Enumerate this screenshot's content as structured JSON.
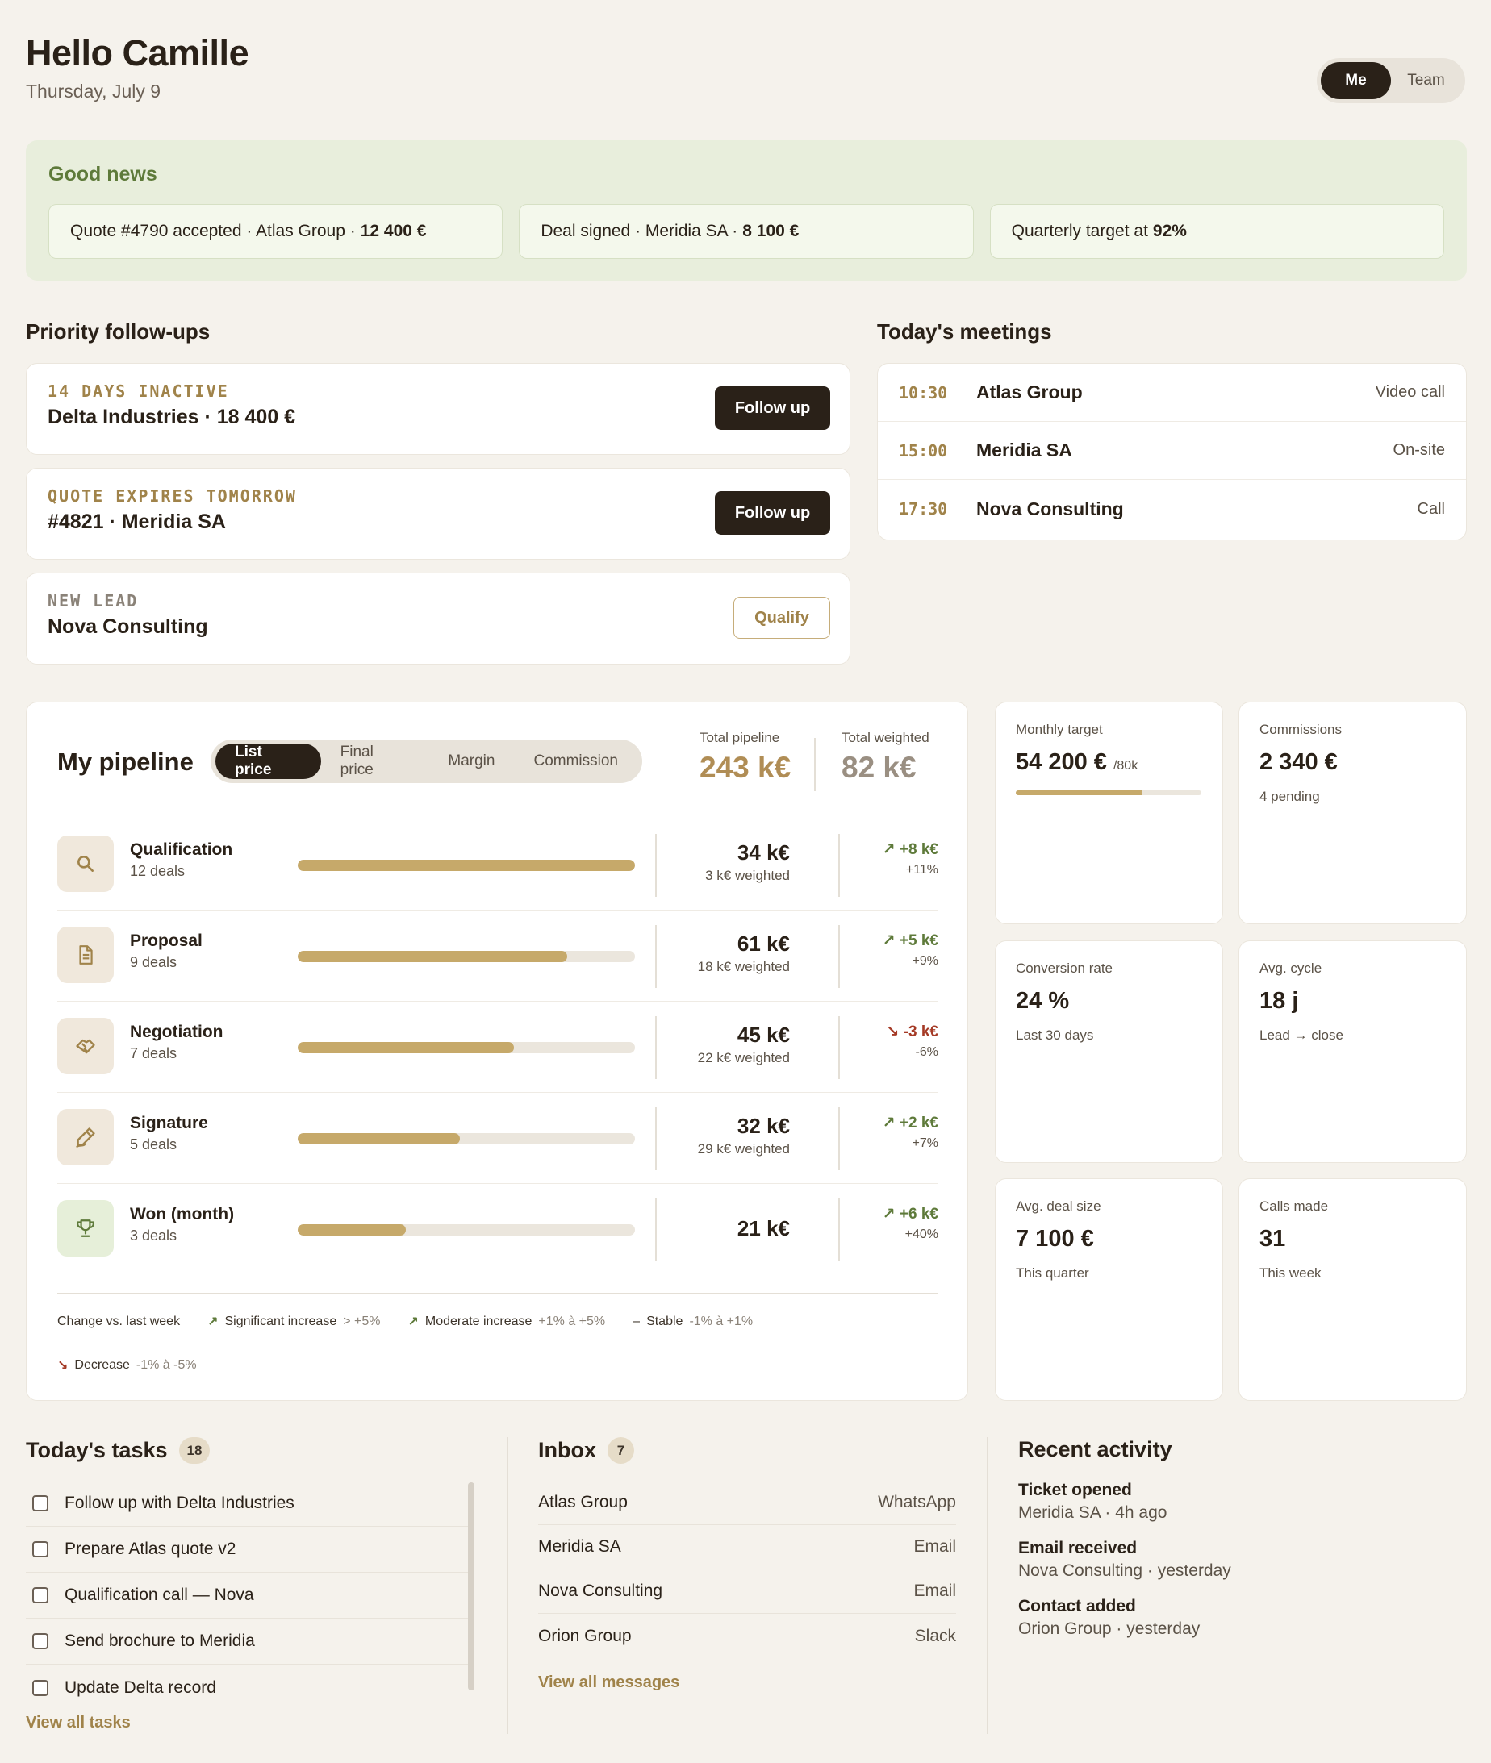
{
  "header": {
    "greeting": "Hello Camille",
    "date": "Thursday, July 9",
    "toggle": [
      "Me",
      "Team"
    ]
  },
  "good_news": {
    "title": "Good news",
    "items": [
      {
        "text": "Quote #4790 accepted · Atlas Group ·",
        "bold": "12 400 €"
      },
      {
        "text": "Deal signed · Meridia SA ·",
        "bold": "8 100 €"
      },
      {
        "text": "Quarterly target at",
        "bold": "92%"
      }
    ]
  },
  "followups": {
    "title": "Priority follow-ups",
    "items": [
      {
        "tag": "14 DAYS INACTIVE",
        "name": "Delta Industries · 18 400 €",
        "action": "Follow up"
      },
      {
        "tag": "QUOTE EXPIRES TOMORROW",
        "name": "#4821 · Meridia SA",
        "action": "Follow up"
      },
      {
        "tag": "NEW LEAD",
        "name": "Nova Consulting",
        "action": "Qualify"
      }
    ]
  },
  "meetings": {
    "title": "Today's meetings",
    "items": [
      {
        "time": "10:30",
        "name": "Atlas Group",
        "type": "Video call"
      },
      {
        "time": "15:00",
        "name": "Meridia SA",
        "type": "On-site"
      },
      {
        "time": "17:30",
        "name": "Nova Consulting",
        "type": "Call"
      }
    ]
  },
  "pipeline": {
    "title": "My pipeline",
    "tabs": [
      "List price",
      "Final price",
      "Margin",
      "Commission"
    ],
    "total_label": "Total pipeline",
    "total_value": "243 k€",
    "weighted_label": "Total weighted",
    "weighted_value": "82 k€",
    "stages": [
      {
        "name": "Qualification",
        "deals": "12 deals",
        "value": "34 k€",
        "weighted": "3 k€ weighted",
        "change": "+8 k€",
        "pct": "+11%",
        "progress": 1.0,
        "dir": "up"
      },
      {
        "name": "Proposal",
        "deals": "9 deals",
        "value": "61 k€",
        "weighted": "18 k€ weighted",
        "change": "+5 k€",
        "pct": "+9%",
        "progress": 0.8,
        "dir": "up"
      },
      {
        "name": "Negotiation",
        "deals": "7 deals",
        "value": "45 k€",
        "weighted": "22 k€ weighted",
        "change": "-3 k€",
        "pct": "-6%",
        "progress": 0.64,
        "dir": "down"
      },
      {
        "name": "Signature",
        "deals": "5 deals",
        "value": "32 k€",
        "weighted": "29 k€ weighted",
        "change": "+2 k€",
        "pct": "+7%",
        "progress": 0.48,
        "dir": "up"
      },
      {
        "name": "Won (month)",
        "deals": "3 deals",
        "value": "21 k€",
        "weighted": "",
        "change": "+6 k€",
        "pct": "+40%",
        "progress": 0.32,
        "dir": "up"
      }
    ],
    "legend": {
      "label": "Change vs. last week",
      "items": [
        {
          "name": "Significant increase",
          "range": "> +5%"
        },
        {
          "name": "Moderate increase",
          "range": "+1% à +5%"
        },
        {
          "name": "Stable",
          "range": "-1% à +1%"
        },
        {
          "name": "Decrease",
          "range": "-1% à -5%"
        }
      ]
    }
  },
  "kpis": [
    {
      "label": "Monthly target",
      "value": "54 200 €",
      "suffix": "/80k",
      "sub": "",
      "progress": 0.68
    },
    {
      "label": "Commissions",
      "value": "2 340 €",
      "suffix": "",
      "sub": "4 pending"
    },
    {
      "label": "Conversion rate",
      "value": "24 %",
      "suffix": "",
      "sub": "Last 30 days"
    },
    {
      "label": "Avg. cycle",
      "value": "18 j",
      "suffix": "",
      "sub": "Lead → close"
    },
    {
      "label": "Avg. deal size",
      "value": "7 100 €",
      "suffix": "",
      "sub": "This quarter"
    },
    {
      "label": "Calls made",
      "value": "31",
      "suffix": "",
      "sub": "This week"
    }
  ],
  "tasks": {
    "title": "Today's tasks",
    "count": "18",
    "items": [
      "Follow up with Delta Industries",
      "Prepare Atlas quote v2",
      "Qualification call — Nova",
      "Send brochure to Meridia",
      "Update Delta record"
    ],
    "link": "View all tasks"
  },
  "inbox": {
    "title": "Inbox",
    "count": "7",
    "items": [
      {
        "name": "Atlas Group",
        "channel": "WhatsApp"
      },
      {
        "name": "Meridia SA",
        "channel": "Email"
      },
      {
        "name": "Nova Consulting",
        "channel": "Email"
      },
      {
        "name": "Orion Group",
        "channel": "Slack"
      }
    ],
    "link": "View all messages"
  },
  "activity": {
    "title": "Recent activity",
    "items": [
      {
        "title": "Ticket opened",
        "sub": "Meridia SA · 4h ago"
      },
      {
        "title": "Email received",
        "sub": "Nova Consulting · yesterday"
      },
      {
        "title": "Contact added",
        "sub": "Orion Group · yesterday"
      }
    ]
  }
}
